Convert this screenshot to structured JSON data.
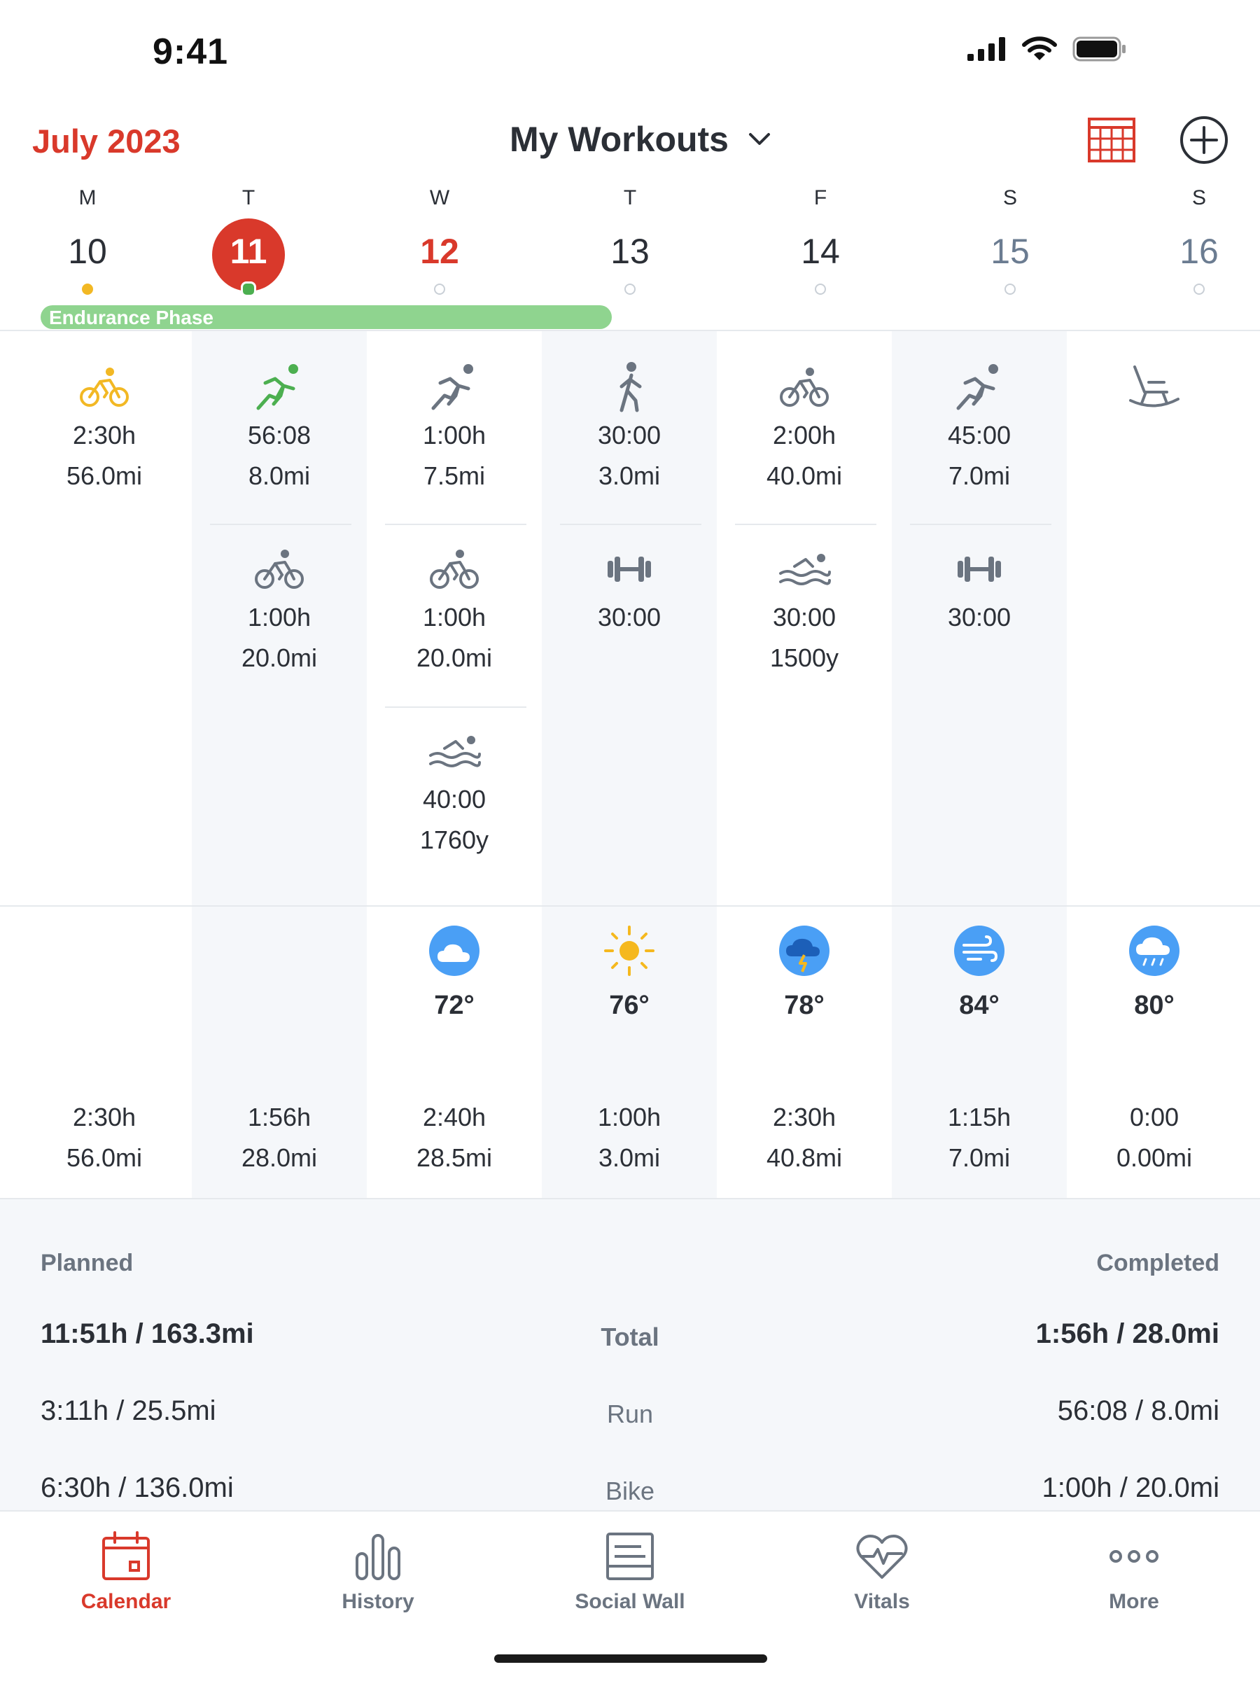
{
  "status_bar": {
    "time": "9:41"
  },
  "header": {
    "month": "July 2023",
    "title": "My Workouts"
  },
  "week": {
    "days": [
      {
        "letter": "M",
        "num": "10"
      },
      {
        "letter": "T",
        "num": "11"
      },
      {
        "letter": "W",
        "num": "12"
      },
      {
        "letter": "T",
        "num": "13"
      },
      {
        "letter": "F",
        "num": "14"
      },
      {
        "letter": "S",
        "num": "15"
      },
      {
        "letter": "S",
        "num": "16"
      }
    ],
    "phase": "Endurance Phase"
  },
  "workouts": {
    "mon": {
      "bike": {
        "duration": "2:30h",
        "distance": "56.0mi"
      }
    },
    "tue": {
      "run": {
        "duration": "56:08",
        "distance": "8.0mi"
      },
      "bike": {
        "duration": "1:00h",
        "distance": "20.0mi"
      }
    },
    "wed": {
      "run": {
        "duration": "1:00h",
        "distance": "7.5mi"
      },
      "bike": {
        "duration": "1:00h",
        "distance": "20.0mi"
      },
      "swim": {
        "duration": "40:00",
        "distance": "1760y"
      }
    },
    "thu": {
      "walk": {
        "duration": "30:00",
        "distance": "3.0mi"
      },
      "strength": {
        "duration": "30:00"
      }
    },
    "fri": {
      "bike": {
        "duration": "2:00h",
        "distance": "40.0mi"
      },
      "swim": {
        "duration": "30:00",
        "distance": "1500y"
      }
    },
    "sat": {
      "run": {
        "duration": "45:00",
        "distance": "7.0mi"
      },
      "strength": {
        "duration": "30:00"
      }
    },
    "sun": {
      "rest_icon": "rocking-chair-icon"
    }
  },
  "weather": [
    {
      "day": "wed",
      "icon": "partly-cloudy-icon",
      "temp": "72°"
    },
    {
      "day": "thu",
      "icon": "sun-icon",
      "temp": "76°"
    },
    {
      "day": "fri",
      "icon": "thunderstorm-icon",
      "temp": "78°"
    },
    {
      "day": "sat",
      "icon": "wind-icon",
      "temp": "84°"
    },
    {
      "day": "sun",
      "icon": "rain-icon",
      "temp": "80°"
    }
  ],
  "day_totals": [
    {
      "duration": "2:30h",
      "distance": "56.0mi"
    },
    {
      "duration": "1:56h",
      "distance": "28.0mi"
    },
    {
      "duration": "2:40h",
      "distance": "28.5mi"
    },
    {
      "duration": "1:00h",
      "distance": "3.0mi"
    },
    {
      "duration": "2:30h",
      "distance": "40.8mi"
    },
    {
      "duration": "1:15h",
      "distance": "7.0mi"
    },
    {
      "duration": "0:00",
      "distance": "0.00mi"
    }
  ],
  "summary": {
    "planned_label": "Planned",
    "completed_label": "Completed",
    "rows": [
      {
        "planned": "11:51h / 163.3mi",
        "label": "Total",
        "completed": "1:56h / 28.0mi"
      },
      {
        "planned": "3:11h / 25.5mi",
        "label": "Run",
        "completed": "56:08 / 8.0mi"
      },
      {
        "planned": "6:30h / 136.0mi",
        "label": "Bike",
        "completed": "1:00h / 20.0mi"
      }
    ]
  },
  "tabs": [
    {
      "label": "Calendar",
      "icon": "calendar-icon"
    },
    {
      "label": "History",
      "icon": "bar-chart-icon"
    },
    {
      "label": "Social Wall",
      "icon": "newsfeed-icon"
    },
    {
      "label": "Vitals",
      "icon": "heart-pulse-icon"
    },
    {
      "label": "More",
      "icon": "more-dots-icon"
    }
  ],
  "colors": {
    "accent": "#d9392b",
    "bike_completed": "#f2b824",
    "run_completed": "#4caf50",
    "phase": "#8fd48f",
    "icon_gray": "#6b7480",
    "weather_blue": "#4a9ff5"
  }
}
